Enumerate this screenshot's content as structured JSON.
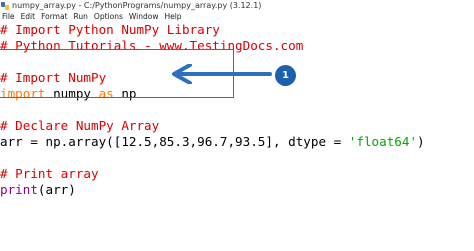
{
  "window": {
    "title": "numpy_array.py - C:/PythonPrograms/numpy_array.py (3.12.1)"
  },
  "menu": {
    "items": [
      "File",
      "Edit",
      "Format",
      "Run",
      "Options",
      "Window",
      "Help"
    ]
  },
  "code": {
    "lines": [
      {
        "tokens": [
          {
            "t": "# Import Python NumPy Library",
            "k": "comment"
          }
        ]
      },
      {
        "tokens": [
          {
            "t": "# Python Tutorials - www.TestingDocs.com",
            "k": "comment"
          }
        ]
      },
      {
        "tokens": []
      },
      {
        "tokens": [
          {
            "t": "# Import NumPy",
            "k": "comment"
          }
        ]
      },
      {
        "tokens": [
          {
            "t": "import",
            "k": "keyword"
          },
          {
            "t": " numpy ",
            "k": "plain"
          },
          {
            "t": "as",
            "k": "keyword"
          },
          {
            "t": " np",
            "k": "plain"
          }
        ]
      },
      {
        "tokens": []
      },
      {
        "tokens": [
          {
            "t": "# Declare NumPy Array",
            "k": "comment"
          }
        ]
      },
      {
        "tokens": [
          {
            "t": "arr = np.array([12.5,85.3,96.7,93.5], dtype = ",
            "k": "plain"
          },
          {
            "t": "'float64'",
            "k": "string"
          },
          {
            "t": ")",
            "k": "plain"
          }
        ]
      },
      {
        "tokens": []
      },
      {
        "tokens": [
          {
            "t": "# Print array",
            "k": "comment"
          }
        ]
      },
      {
        "tokens": [
          {
            "t": "print",
            "k": "builtin"
          },
          {
            "t": "(arr)",
            "k": "plain"
          }
        ]
      }
    ]
  },
  "callout": {
    "number": "1",
    "color": "#1f5fb0"
  }
}
